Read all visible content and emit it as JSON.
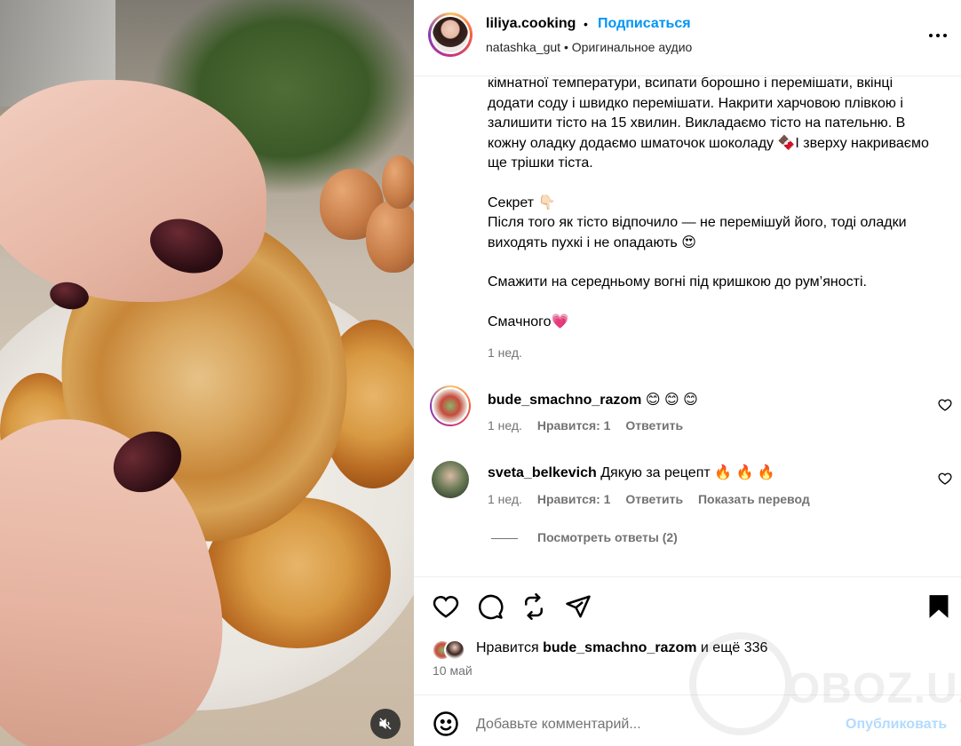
{
  "header": {
    "username": "liliya.cooking",
    "separator": "•",
    "follow_label": "Подписаться",
    "audio_author": "natashka_gut",
    "audio_separator": "•",
    "audio_label": "Оригинальное аудио"
  },
  "caption": {
    "paragraph1": "кімнатної температури, всипати борошно і перемішати, вкінці додати соду і швидко перемішати. Накрити харчовою плівкою і залишити тісто на 15 хвилин. Викладаємо тісто на пательню. В кожну оладку додаємо шматочок шоколаду 🍫І зверху накриваємо ще трішки тіста.",
    "secret_title": "Секрет 👇🏻",
    "secret_text": "Після того як тісто відпочило — не перемішуй його, тоді оладки виходять пухкі і не опадають 😍",
    "cook_text": "Смажити на середньому вогні під кришкою до рум’яності.",
    "closing": "Смачного💗",
    "time": "1 нед."
  },
  "comments": [
    {
      "username": "bude_smachno_razom",
      "text": "😊 😊 😊",
      "time": "1 нед.",
      "likes": "Нравится: 1",
      "reply": "Ответить"
    },
    {
      "username": "sveta_belkevich",
      "text": "Дякую за рецепт 🔥 🔥 🔥",
      "time": "1 нед.",
      "likes": "Нравится: 1",
      "reply": "Ответить",
      "translate": "Показать перевод"
    }
  ],
  "view_replies": "Посмотреть ответы (2)",
  "likes": {
    "prefix": "Нравится",
    "user": "bude_smachno_razom",
    "suffix": "и ещё 336"
  },
  "date": "10 май",
  "add_comment": {
    "placeholder": "Добавьте комментарий...",
    "post_label": "Опубликовать"
  },
  "watermark": "OBOZ.UA",
  "icons": {
    "like": "heart-icon",
    "comment": "comment-icon",
    "repost": "repost-icon",
    "share": "share-icon",
    "save": "bookmark-icon",
    "more": "more-icon",
    "emoji": "emoji-icon",
    "mute": "muted-icon"
  },
  "colors": {
    "accent": "#0095f6",
    "post_disabled": "#b3dbff",
    "muted_text": "#737373"
  }
}
